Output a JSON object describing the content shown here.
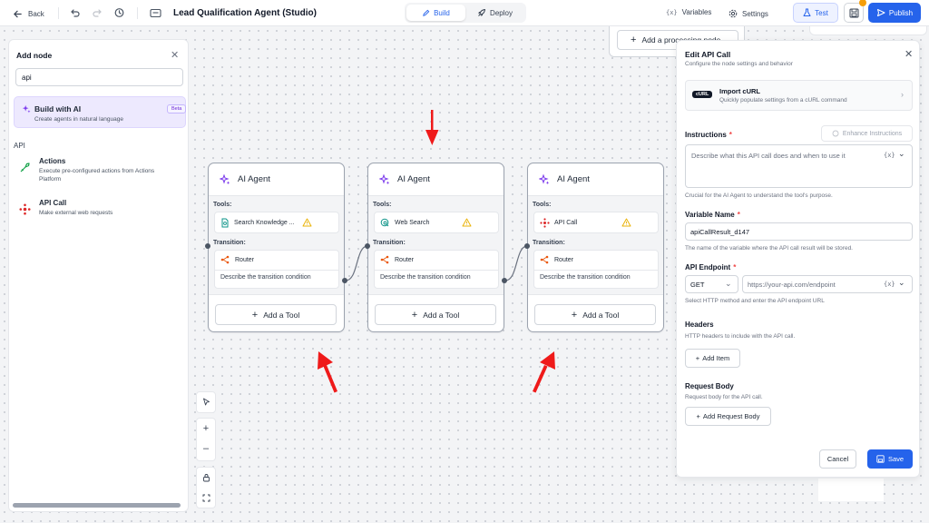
{
  "topbar": {
    "back_label": "Back",
    "title": "Lead Qualification Agent (Studio)",
    "tabs": [
      {
        "label": "Build",
        "active": true
      },
      {
        "label": "Deploy",
        "active": false
      }
    ],
    "variables_label": "Variables",
    "settings_label": "Settings",
    "test_label": "Test",
    "publish_label": "Publish",
    "accent_color": "#2563eb"
  },
  "add_node_panel": {
    "title": "Add node",
    "search_value": "api",
    "build_with_ai": {
      "title": "Build with AI",
      "subtitle": "Create agents in natural language",
      "badge": "Beta"
    },
    "section_label": "API",
    "items": [
      {
        "title": "Actions",
        "subtitle": "Execute pre-configured actions from Actions Platform",
        "icon": "puzzle-icon"
      },
      {
        "title": "API Call",
        "subtitle": "Make external web requests",
        "icon": "api-icon"
      }
    ]
  },
  "canvas": {
    "background_node_button": "Add a processing node",
    "cards": [
      {
        "title": "AI Agent",
        "tools_label": "Tools:",
        "tool_name": "Search Knowledge ...",
        "tool_icon": "document-search-icon",
        "transition_label": "Transition:",
        "router_label": "Router",
        "transition_desc": "Describe the transition condition",
        "add_tool_label": "Add a Tool"
      },
      {
        "title": "AI Agent",
        "tools_label": "Tools:",
        "tool_name": "Web Search",
        "tool_icon": "web-search-icon",
        "transition_label": "Transition:",
        "router_label": "Router",
        "transition_desc": "Describe the transition condition",
        "add_tool_label": "Add a Tool"
      },
      {
        "title": "AI Agent",
        "tools_label": "Tools:",
        "tool_name": "API Call",
        "tool_icon": "api-icon",
        "transition_label": "Transition:",
        "router_label": "Router",
        "transition_desc": "Describe the transition condition",
        "add_tool_label": "Add a Tool"
      }
    ],
    "annotation_color": "#ef1a1a"
  },
  "edit_panel": {
    "title": "Edit API Call",
    "subtitle": "Configure the node settings and behavior",
    "curl": {
      "badge": "cURL",
      "title": "Import cURL",
      "subtitle": "Quickly populate settings from a cURL command"
    },
    "instructions": {
      "label": "Instructions",
      "enhance_label": "Enhance Instructions",
      "placeholder": "Describe what this API call does and when to use it",
      "help": "Crucial for the AI Agent to understand the tool's purpose."
    },
    "variable_name": {
      "label": "Variable Name",
      "value": "apiCallResult_d147",
      "help": "The name of the variable where the API call result will be stored."
    },
    "api_endpoint": {
      "label": "API Endpoint",
      "method": "GET",
      "placeholder": "https://your-api.com/endpoint",
      "help": "Select HTTP method and enter the API endpoint URL"
    },
    "headers": {
      "label": "Headers",
      "help": "HTTP headers to include with the API call.",
      "add_label": "Add Item"
    },
    "request_body": {
      "label": "Request Body",
      "help": "Request body for the API call.",
      "add_label": "Add Request Body"
    },
    "var_symbol": "{x}",
    "cancel_label": "Cancel",
    "save_label": "Save"
  }
}
